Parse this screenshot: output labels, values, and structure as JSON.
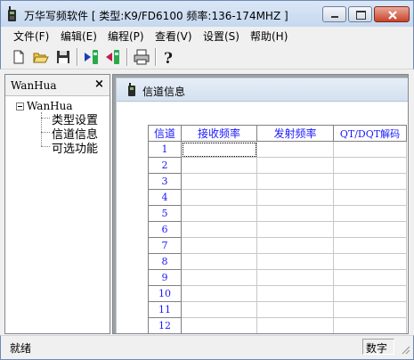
{
  "window": {
    "title": "万华写频软件 [ 类型:K9/FD6100  频率:136-174MHZ ]"
  },
  "menu": [
    {
      "label": "文件(F)"
    },
    {
      "label": "编辑(E)"
    },
    {
      "label": "编程(P)"
    },
    {
      "label": "查看(V)"
    },
    {
      "label": "设置(S)"
    },
    {
      "label": "帮助(H)"
    }
  ],
  "toolbar": {
    "icons": [
      "new-icon",
      "open-icon",
      "save-icon",
      "read-from-radio-icon",
      "write-to-radio-icon",
      "print-icon",
      "help-icon"
    ]
  },
  "left_panel": {
    "title": "WanHua",
    "close_label": "×",
    "tree": {
      "root": "WanHua",
      "items": [
        "类型设置",
        "信道信息",
        "可选功能"
      ]
    }
  },
  "child_window": {
    "title": "信道信息"
  },
  "grid": {
    "headers": [
      "信道",
      "接收频率",
      "发射频率",
      "QT/DQT解码"
    ],
    "rows": [
      "1",
      "2",
      "3",
      "4",
      "5",
      "6",
      "7",
      "8",
      "9",
      "10",
      "11",
      "12"
    ]
  },
  "status": {
    "text": "就绪",
    "indicator": "数字"
  },
  "colors": {
    "header_text": "#1a1aff",
    "titlebar": "#c5d8ef",
    "close_button": "#c9432b"
  }
}
